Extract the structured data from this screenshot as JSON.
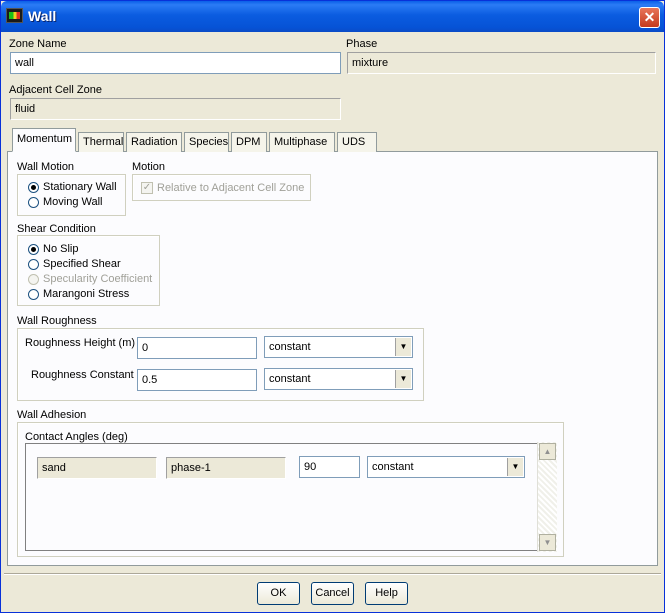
{
  "window": {
    "title": "Wall",
    "close_glyph": "✕"
  },
  "zone_name": {
    "label": "Zone Name",
    "value": "wall"
  },
  "phase": {
    "label": "Phase",
    "value": "mixture"
  },
  "adjacent_cell_zone": {
    "label": "Adjacent Cell Zone",
    "value": "fluid"
  },
  "tabs": [
    {
      "label": "Momentum",
      "active": true
    },
    {
      "label": "Thermal"
    },
    {
      "label": "Radiation"
    },
    {
      "label": "Species"
    },
    {
      "label": "DPM"
    },
    {
      "label": "Multiphase"
    },
    {
      "label": "UDS"
    }
  ],
  "wall_motion": {
    "label": "Wall Motion",
    "options": [
      {
        "label": "Stationary Wall",
        "selected": true
      },
      {
        "label": "Moving Wall",
        "selected": false
      }
    ]
  },
  "motion": {
    "label": "Motion",
    "relative_checkbox": {
      "label": "Relative to Adjacent Cell Zone",
      "checked": true,
      "enabled": false
    }
  },
  "shear_condition": {
    "label": "Shear Condition",
    "options": [
      {
        "label": "No Slip",
        "selected": true
      },
      {
        "label": "Specified Shear",
        "selected": false
      },
      {
        "label": "Specularity Coefficient",
        "selected": false,
        "enabled": false
      },
      {
        "label": "Marangoni Stress",
        "selected": false
      }
    ]
  },
  "wall_roughness": {
    "label": "Wall Roughness",
    "height": {
      "label": "Roughness Height (m)",
      "value": "0",
      "method": "constant"
    },
    "constant": {
      "label": "Roughness Constant",
      "value": "0.5",
      "method": "constant"
    }
  },
  "wall_adhesion": {
    "label": "Wall Adhesion",
    "contact_angles_label": "Contact Angles (deg)",
    "row": {
      "phase_a": "sand",
      "phase_b": "phase-1",
      "angle": "90",
      "method": "constant"
    }
  },
  "buttons": {
    "ok": "OK",
    "cancel": "Cancel",
    "help": "Help"
  },
  "icons": {
    "combo_arrow": "▼",
    "scroll_up": "▲",
    "scroll_down": "▼",
    "check": "✓"
  }
}
